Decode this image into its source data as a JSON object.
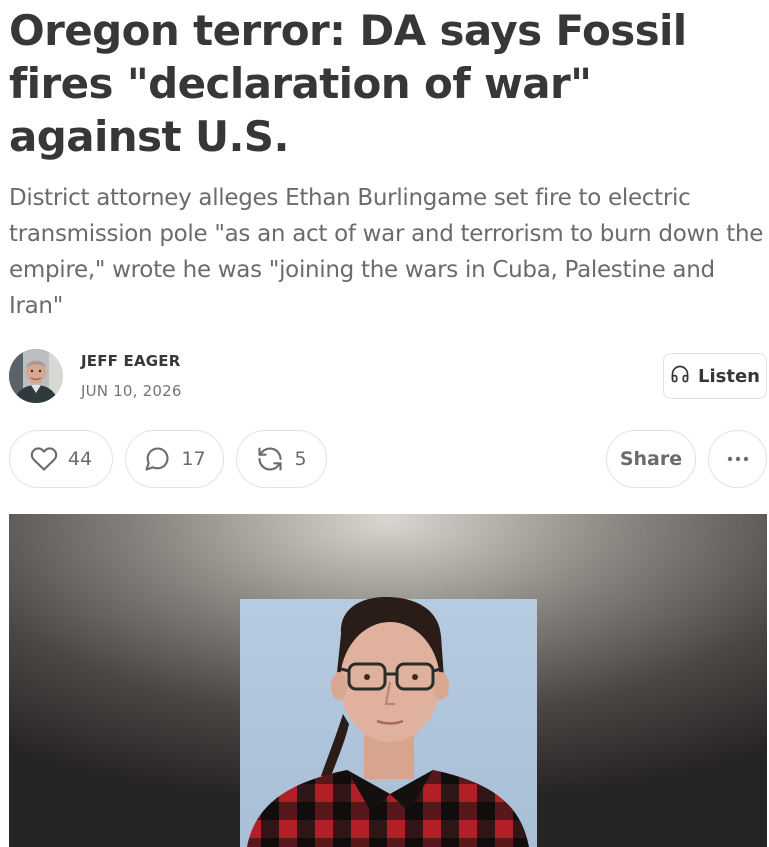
{
  "post": {
    "title": "Oregon terror: DA says Fossil fires \"declaration of war\" against U.S.",
    "subtitle": "District attorney alleges Ethan Burlingame set fire to electric transmission pole \"as an act of war and terrorism to burn down the empire,\" wrote he was \"joining the wars in Cuba, Palestine and Iran\"",
    "author": "JEFF EAGER",
    "date": "JUN 10, 2026",
    "listen_label": "Listen"
  },
  "actions": {
    "likes": "44",
    "comments": "17",
    "restacks": "5",
    "share_label": "Share"
  },
  "icons": {
    "listen": "headphones-icon",
    "like": "heart-icon",
    "comment": "comment-bubble-icon",
    "restack": "restack-arrows-icon",
    "more": "more-dots-icon"
  },
  "colors": {
    "text": "#363737",
    "muted": "#6b6b6b",
    "border": "#e3e3e3"
  }
}
